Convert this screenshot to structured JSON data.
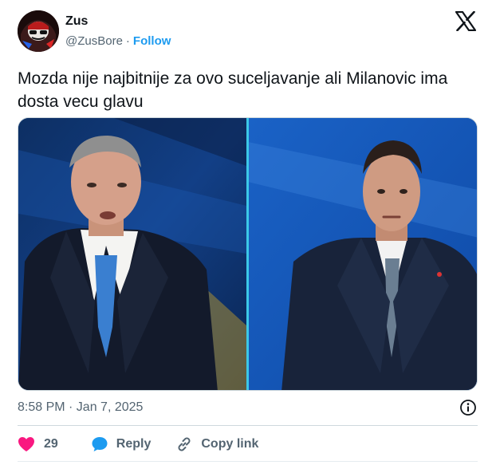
{
  "author": {
    "name": "Zus",
    "handle": "@ZusBore",
    "separator": "·",
    "follow_label": "Follow"
  },
  "tweet": {
    "text": "Mozda nije najbitnije za ovo suceljavanje ali Milanovic ima dosta vecu glavu"
  },
  "meta": {
    "timestamp": "8:58 PM · Jan 7, 2025"
  },
  "actions": {
    "likes": "29",
    "reply_label": "Reply",
    "copy_link_label": "Copy link"
  },
  "colors": {
    "accent": "#1d9bf0",
    "like": "#f91880",
    "text_secondary": "#536471"
  },
  "icons": {
    "brand": "x-logo-icon",
    "info": "info-icon",
    "like": "heart-icon",
    "reply": "reply-bubble-icon",
    "copy": "link-icon"
  }
}
